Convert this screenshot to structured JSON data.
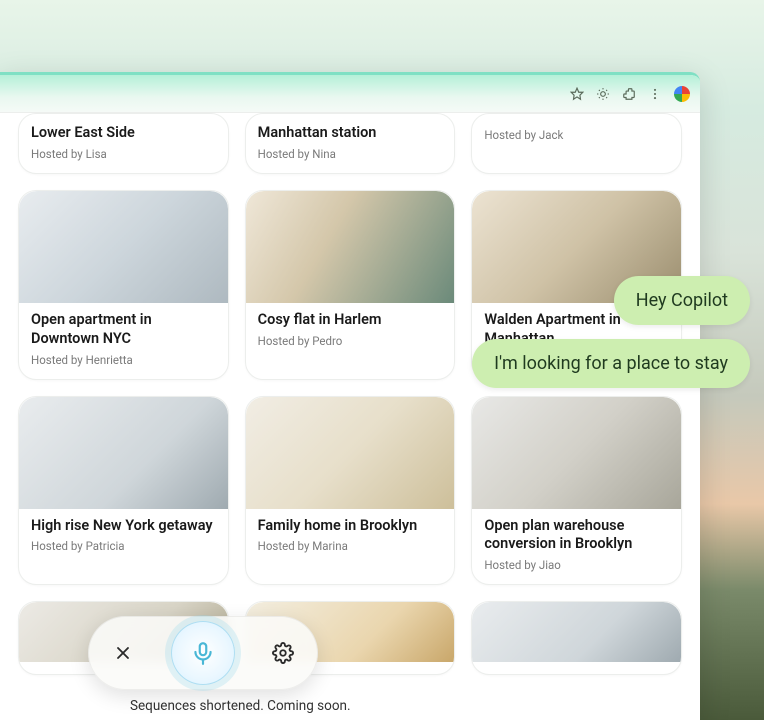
{
  "listings": {
    "row0": [
      {
        "title": "Lower East Side",
        "host": "Hosted by Lisa"
      },
      {
        "title": "Manhattan station",
        "host": "Hosted by Nina"
      },
      {
        "title": "",
        "host": "Hosted by Jack"
      }
    ],
    "row1": [
      {
        "title": "Open apartment in Downtown NYC",
        "host": "Hosted by Henrietta"
      },
      {
        "title": "Cosy flat in Harlem",
        "host": "Hosted by Pedro"
      },
      {
        "title": "Walden Apartment in Manhattan",
        "host": ""
      }
    ],
    "row2": [
      {
        "title": "High rise New York getaway",
        "host": "Hosted by Patricia"
      },
      {
        "title": "Family home in Brooklyn",
        "host": "Hosted by Marina"
      },
      {
        "title": "Open plan warehouse conversion in Brooklyn",
        "host": "Hosted by Jiao"
      }
    ]
  },
  "chat": {
    "msg1": "Hey Copilot",
    "msg2": "I'm looking for a place to stay"
  },
  "footer": "Sequences shortened. Coming soon."
}
